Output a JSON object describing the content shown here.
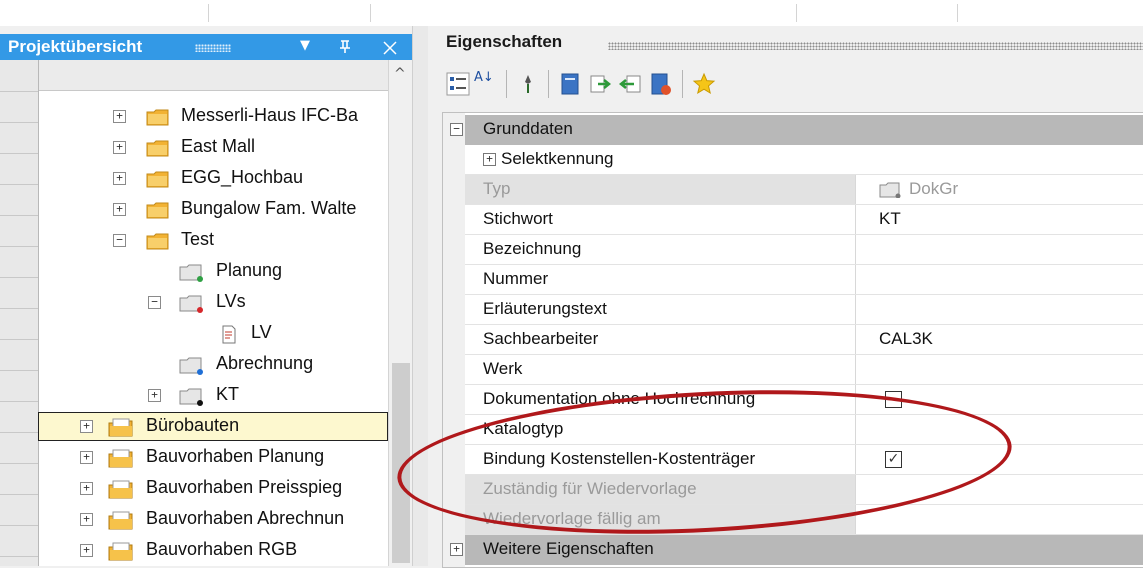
{
  "colors": {
    "accent": "#3399e6",
    "selection": "#fdf8cf",
    "annotation": "#b0181b"
  },
  "left_panel": {
    "title": "Projektübersicht",
    "controls": [
      "▾",
      "ᵖ",
      "✕"
    ],
    "tree": [
      {
        "label": "Messerli-Haus IFC-Ba",
        "expander": "+",
        "icon": "folder-icon"
      },
      {
        "label": "East Mall",
        "expander": "+",
        "icon": "folder-icon"
      },
      {
        "label": "EGG_Hochbau",
        "expander": "+",
        "icon": "folder-icon"
      },
      {
        "label": "Bungalow Fam. Walte",
        "expander": "+",
        "icon": "folder-icon"
      },
      {
        "label": "Test",
        "expander": "−",
        "icon": "folder-icon"
      },
      {
        "label": "Planung",
        "expander": "",
        "icon": "doc-group-green-icon"
      },
      {
        "label": "LVs",
        "expander": "−",
        "icon": "doc-group-red-icon"
      },
      {
        "label": "LV",
        "expander": "",
        "icon": "document-icon"
      },
      {
        "label": "Abrechnung",
        "expander": "",
        "icon": "doc-group-blue-icon"
      },
      {
        "label": "KT",
        "expander": "+",
        "icon": "doc-group-black-icon",
        "selected": true
      },
      {
        "label": "Bürobauten",
        "expander": "+",
        "icon": "project-folder-icon"
      },
      {
        "label": "Bauvorhaben Planung",
        "expander": "+",
        "icon": "project-folder-icon"
      },
      {
        "label": "Bauvorhaben Preisspieg",
        "expander": "+",
        "icon": "project-folder-icon"
      },
      {
        "label": "Bauvorhaben Abrechnun",
        "expander": "+",
        "icon": "project-folder-icon"
      },
      {
        "label": "Bauvorhaben RGB",
        "expander": "+",
        "icon": "project-folder-icon"
      }
    ]
  },
  "right_panel": {
    "title": "Eigenschaften",
    "toolbar": [
      "categorized-icon",
      "sort-az-icon",
      "pin-icon",
      "page-icon",
      "export-icon",
      "import-icon",
      "report-icon",
      "star-icon"
    ],
    "sort_glyph": "A↓",
    "category_grunddaten": {
      "label": "Grunddaten",
      "expander": "−"
    },
    "selektkennung": {
      "label": "Selektkennung",
      "expander": "+"
    },
    "properties": [
      {
        "key": "Typ",
        "value": "DokGr",
        "disabled": true
      },
      {
        "key": "Stichwort",
        "value": "KT"
      },
      {
        "key": "Bezeichnung",
        "value": ""
      },
      {
        "key": "Nummer",
        "value": ""
      },
      {
        "key": "Erläuterungstext",
        "value": ""
      },
      {
        "key": "Sachbearbeiter",
        "value": "CAL3K"
      },
      {
        "key": "Werk",
        "value": ""
      },
      {
        "key": "Dokumentation ohne Hochrechnung",
        "checkbox": false
      },
      {
        "key": "Katalogtyp",
        "value": ""
      },
      {
        "key": "Bindung Kostenstellen-Kostenträger",
        "checkbox": true
      },
      {
        "key": "Zuständig für Wiedervorlage",
        "value": "",
        "disabled": true
      },
      {
        "key": "Wiedervorlage fällig am",
        "value": "",
        "disabled": true
      }
    ],
    "category_weitere": {
      "label": "Weitere Eigenschaften",
      "expander": "+"
    },
    "checkmark": "✓"
  }
}
